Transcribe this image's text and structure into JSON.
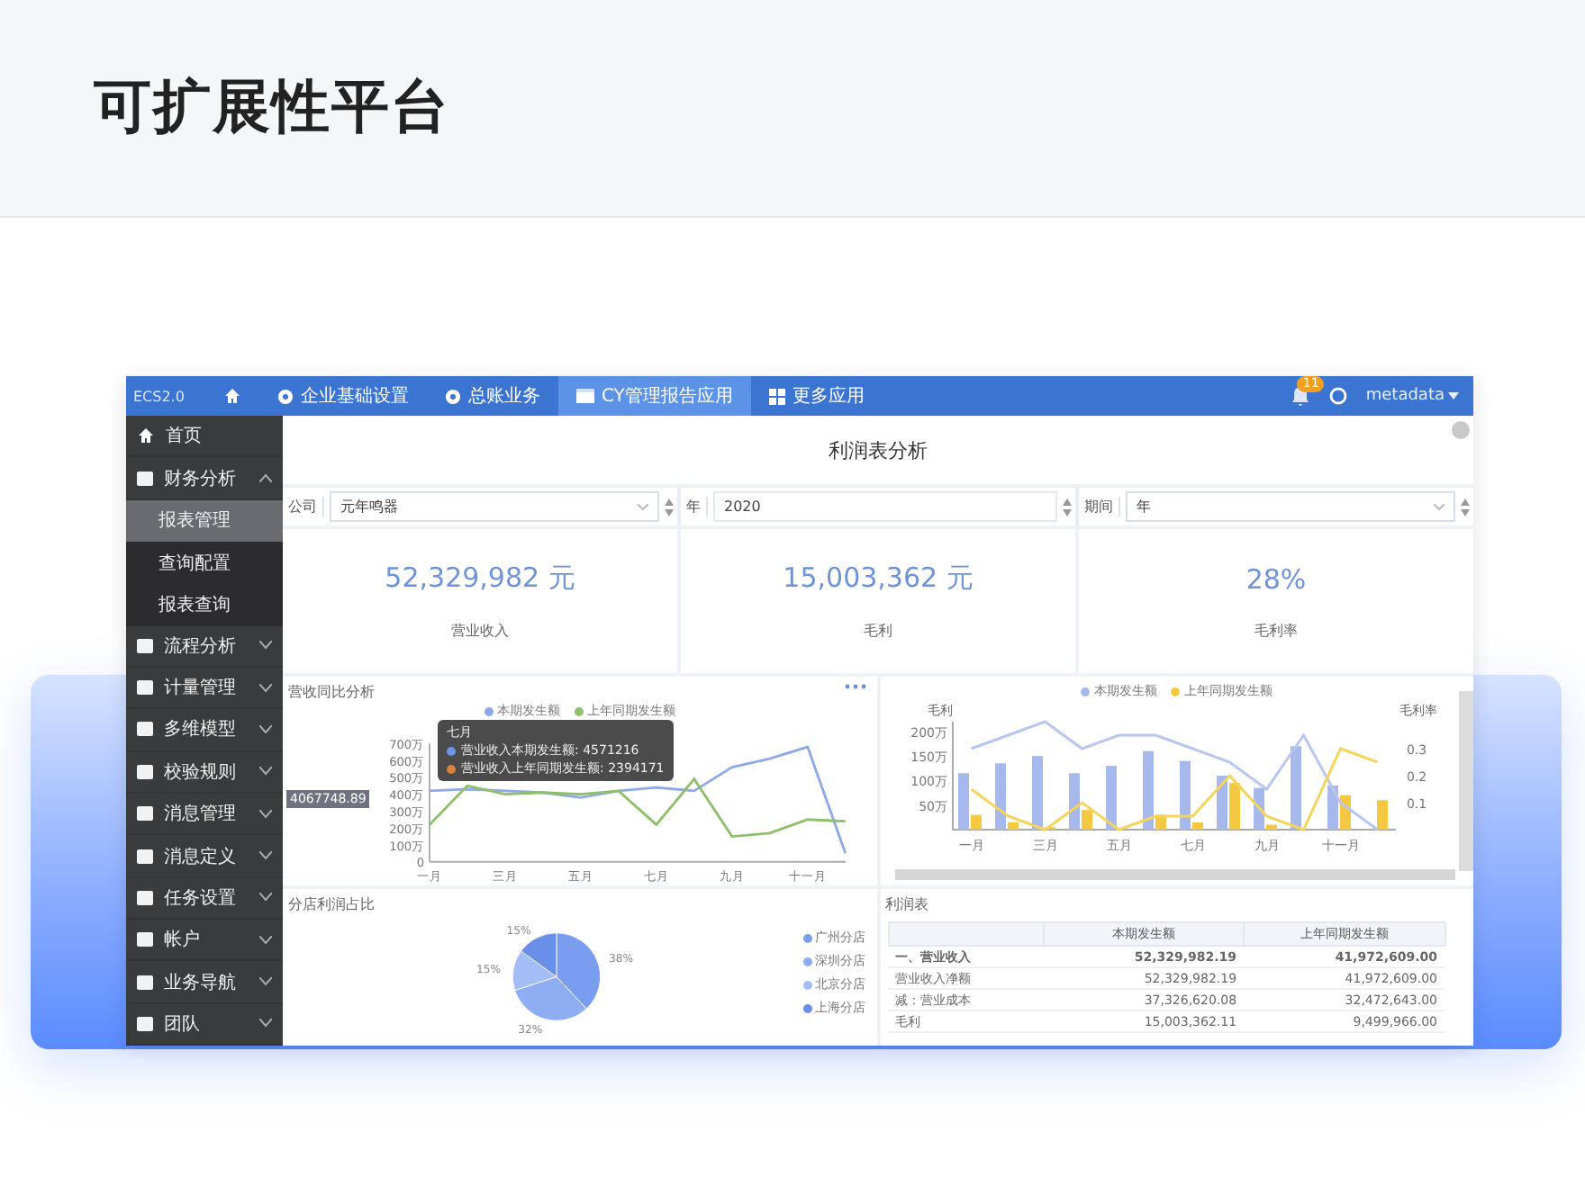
{
  "page_title": "可扩展性平台",
  "app": {
    "topbar": {
      "brand": "ECS2.0",
      "tabs": [
        {
          "kind": "home",
          "selected": false
        },
        {
          "kind": "gear",
          "label": "企业基础设置",
          "selected": false
        },
        {
          "kind": "gear",
          "label": "总账业务",
          "selected": false
        },
        {
          "kind": "window",
          "label": "CY管理报告应用",
          "selected": true
        },
        {
          "kind": "grid",
          "label": "更多应用",
          "selected": false
        }
      ],
      "notification_count": "11",
      "user": "metadata"
    },
    "sidebar": [
      {
        "kind": "link",
        "label": "首页"
      },
      {
        "kind": "group",
        "label": "财务分析",
        "expanded": true,
        "children": [
          {
            "label": "报表管理",
            "selected": true
          },
          {
            "label": "查询配置",
            "selected": false
          },
          {
            "label": "报表查询",
            "selected": false
          }
        ]
      },
      {
        "kind": "group",
        "label": "流程分析",
        "expanded": false
      },
      {
        "kind": "group",
        "label": "计量管理",
        "expanded": false
      },
      {
        "kind": "group",
        "label": "多维模型",
        "expanded": false
      },
      {
        "kind": "group",
        "label": "校验规则",
        "expanded": false
      },
      {
        "kind": "group",
        "label": "消息管理",
        "expanded": false
      },
      {
        "kind": "group",
        "label": "消息定义",
        "expanded": false
      },
      {
        "kind": "group",
        "label": "任务设置",
        "expanded": false
      },
      {
        "kind": "group",
        "label": "帐户",
        "expanded": false
      },
      {
        "kind": "group",
        "label": "业务导航",
        "expanded": false
      },
      {
        "kind": "group",
        "label": "团队",
        "expanded": false
      }
    ],
    "report_title": "利润表分析",
    "filters": [
      {
        "label": "公司",
        "value": "元年鸣器",
        "dropdown": true
      },
      {
        "label": "年",
        "value": "2020",
        "dropdown": false
      },
      {
        "label": "期间",
        "value": "年",
        "dropdown": true
      }
    ],
    "kpis": [
      {
        "value": "52,329,982 元",
        "label": "营业收入"
      },
      {
        "value": "15,003,362 元",
        "label": "毛利"
      },
      {
        "value": "28%",
        "label": "毛利率"
      }
    ],
    "revenue_panel": {
      "title": "营收同比分析",
      "chart_data": {
        "type": "line",
        "categories": [
          "一月",
          null,
          "三月",
          null,
          "五月",
          null,
          "七月",
          null,
          "九月",
          null,
          "十一月",
          null
        ],
        "series": [
          {
            "name": "本期发生额",
            "color": "#8fa8e6",
            "values": [
              420,
              430,
              420,
              410,
              380,
              420,
              440,
              420,
              560,
              610,
              680,
              50
            ]
          },
          {
            "name": "上年同期发生额",
            "color": "#8fbf6a",
            "values": [
              220,
              450,
              400,
              410,
              400,
              420,
              220,
              490,
              150,
              170,
              250,
              240
            ]
          }
        ],
        "ylim": [
          0,
          700
        ],
        "yticks": [
          {
            "value": 0,
            "label": "0"
          },
          {
            "value": 100,
            "label": "100万"
          },
          {
            "value": 200,
            "label": "200万"
          },
          {
            "value": 300,
            "label": "300万"
          },
          {
            "value": 400,
            "label": "400万"
          },
          {
            "value": 500,
            "label": "500万"
          },
          {
            "value": 600,
            "label": "600万"
          },
          {
            "value": 700,
            "label": "700万"
          }
        ]
      },
      "axis_pointer": {
        "y_label": "4067748.89"
      },
      "tooltip": {
        "title": "七月",
        "lines": [
          {
            "text": "营业收入本期发生额: 4571216",
            "color": "#6f93e8"
          },
          {
            "text": "营业收入上年同期发生额: 2394171",
            "color": "#d9823b"
          }
        ]
      }
    },
    "margin_panel": {
      "chart_data": {
        "type": "bar",
        "categories": [
          "一月",
          null,
          "三月",
          null,
          "五月",
          null,
          "七月",
          null,
          "九月",
          null,
          "十一月",
          null
        ],
        "series": [
          {
            "name": "本期发生额",
            "color": "#a7b8ec",
            "values": [
              115,
              135,
              150,
              115,
              130,
              160,
              140,
              110,
              85,
              170,
              90,
              0
            ]
          },
          {
            "name": "上年同期发生额",
            "color": "#f5c842",
            "values": [
              30,
              15,
              5,
              40,
              null,
              30,
              15,
              95,
              10,
              0,
              70,
              60
            ]
          },
          {
            "type": "line",
            "axis": "y2",
            "color": "#b9c6ee",
            "values": [
              0.3,
              0.35,
              0.4,
              0.3,
              0.35,
              0.35,
              0.3,
              0.25,
              0.15,
              0.35,
              0.1,
              0
            ]
          },
          {
            "type": "line",
            "axis": "y2",
            "color": "#f5d55c",
            "values": [
              0.15,
              0.05,
              0,
              0.1,
              0,
              0.05,
              0.05,
              0.2,
              0.05,
              0,
              0.3,
              0.25
            ]
          }
        ],
        "ylabel": "毛利",
        "ylim": [
          0,
          220
        ],
        "yticks": [
          {
            "value": 50,
            "label": "50万"
          },
          {
            "value": 100,
            "label": "100万"
          },
          {
            "value": 150,
            "label": "150万"
          },
          {
            "value": 200,
            "label": "200万"
          }
        ],
        "y2label": "毛利率",
        "y2lim": [
          0,
          0.4
        ],
        "y2ticks": [
          0.1,
          0.2,
          0.3
        ]
      }
    },
    "share_panel": {
      "title": "分店利润占比",
      "chart_data": {
        "type": "pie",
        "categories": [
          "广州分店",
          "深圳分店",
          "北京分店",
          "上海分店"
        ],
        "values": [
          38,
          32,
          15,
          15
        ],
        "colors": [
          "#7a9df0",
          "#8eadf3",
          "#a3bdf6",
          "#6a8fe8"
        ],
        "data_labels": "value_labels",
        "value_labels": [
          "38%",
          "32%",
          "15%",
          "15%"
        ]
      }
    },
    "table_panel": {
      "title": "利润表",
      "columns": [
        "本期发生额",
        "上年同期发生额"
      ],
      "rows": [
        {
          "label": "一、营业收入",
          "values": [
            "52,329,982.19",
            "41,972,609.00"
          ],
          "bold": true
        },
        {
          "label": "营业收入净额",
          "values": [
            "52,329,982.19",
            "41,972,609.00"
          ],
          "bold": false
        },
        {
          "label": "减：营业成本",
          "values": [
            "37,326,620.08",
            "32,472,643.00"
          ],
          "bold": false
        },
        {
          "label": "毛利",
          "values": [
            "15,003,362.11",
            "9,499,966.00"
          ],
          "bold": false
        }
      ]
    }
  }
}
